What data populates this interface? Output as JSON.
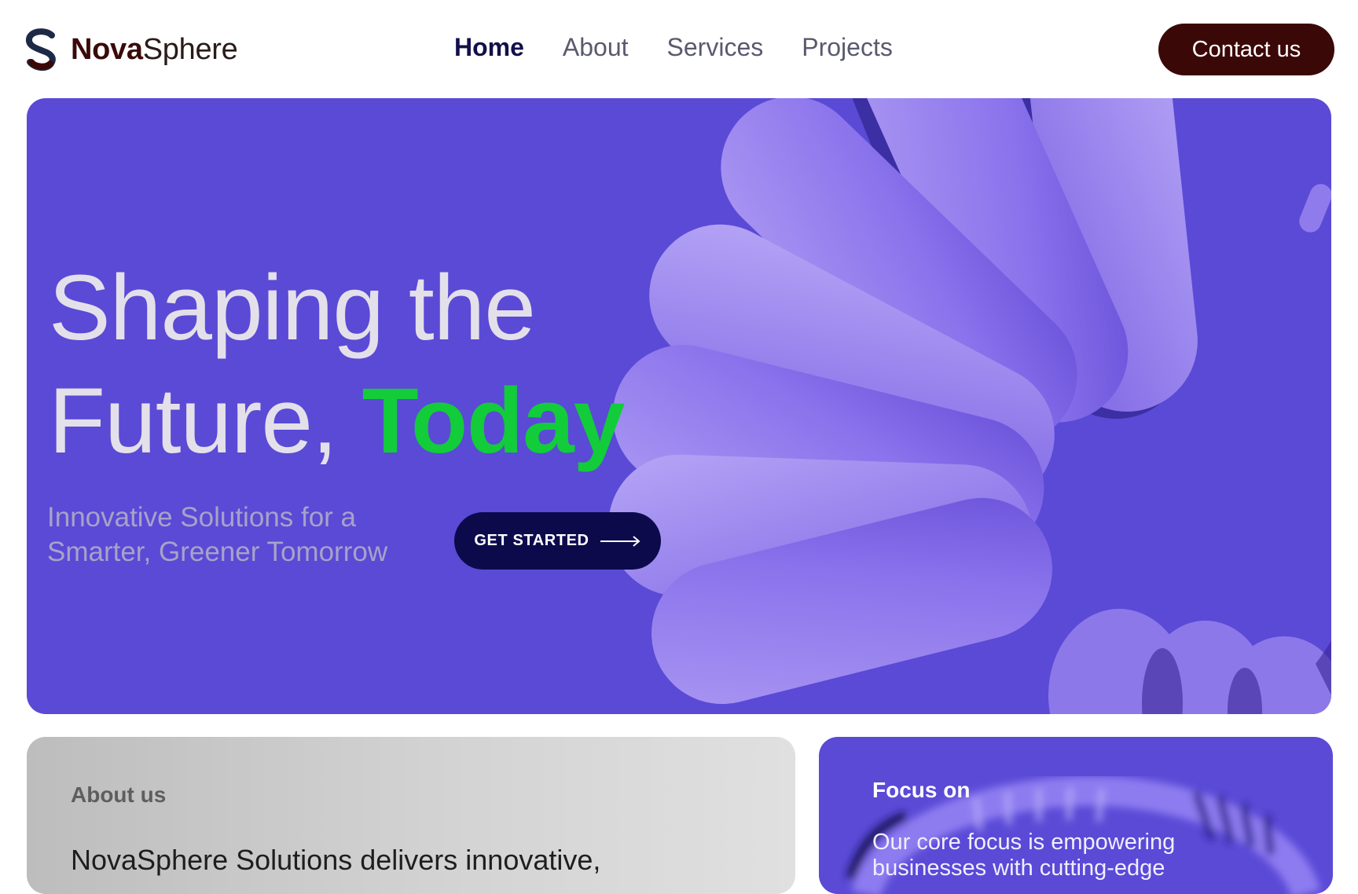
{
  "brand": {
    "name_bold": "Nova",
    "name_regular": "Sphere",
    "icon": "s-logo-icon"
  },
  "nav": {
    "items": [
      {
        "label": "Home",
        "active": true
      },
      {
        "label": "About",
        "active": false
      },
      {
        "label": "Services",
        "active": false
      },
      {
        "label": "Projects",
        "active": false
      }
    ]
  },
  "header": {
    "contact_label": "Contact us"
  },
  "hero": {
    "title_line1": "Shaping the",
    "title_line2_plain": "Future,",
    "title_line2_accent": "Today",
    "subtitle": "Innovative Solutions for a Smarter, Greener Tomorrow",
    "cta_label": "GET STARTED",
    "cta_icon": "arrow-right-icon"
  },
  "about": {
    "label": "About us",
    "text": "NovaSphere Solutions delivers innovative,"
  },
  "focus": {
    "title": "Focus on",
    "text": "Our core focus is empowering businesses with cutting-edge"
  },
  "colors": {
    "hero_bg": "#5a4ad6",
    "accent_green": "#12cc3a",
    "contact_btn": "#3b0808",
    "cta_btn": "#0d0a4c",
    "nav_active": "#12104a"
  }
}
